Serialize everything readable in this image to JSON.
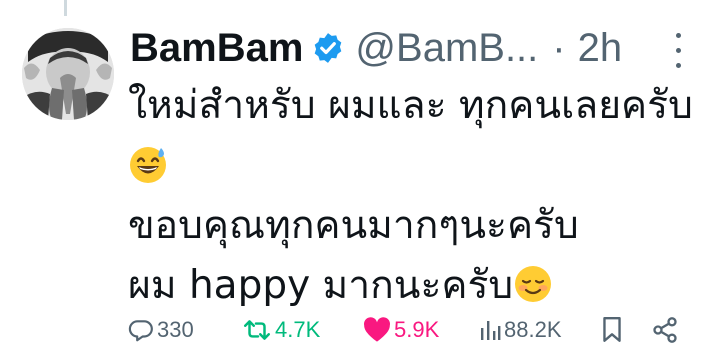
{
  "tweet": {
    "author": {
      "display_name": "BamBam",
      "handle": "@BamB...",
      "verified": true,
      "avatar_icon": "profile-photo"
    },
    "separator": "·",
    "time": "2h",
    "lines": [
      "ใหม่สำหรับ ผมและ ทุกคนเลยครับ",
      "",
      "ขอบคุณทุกคนมากๆนะครับ",
      "ผม happy มากนะครับ"
    ],
    "emojis": [
      "grinning-face-with-sweat",
      "smiling-face"
    ]
  },
  "actions": {
    "reply_count": "330",
    "retweet_count": "4.7K",
    "like_count": "5.9K",
    "views_count": "88.2K"
  },
  "colors": {
    "text": "#0f1419",
    "secondary": "#536471",
    "verified": "#1d9bf0",
    "retweet_active": "#00ba7c",
    "like_active": "#f91880",
    "thread_line": "#cfd9de"
  }
}
